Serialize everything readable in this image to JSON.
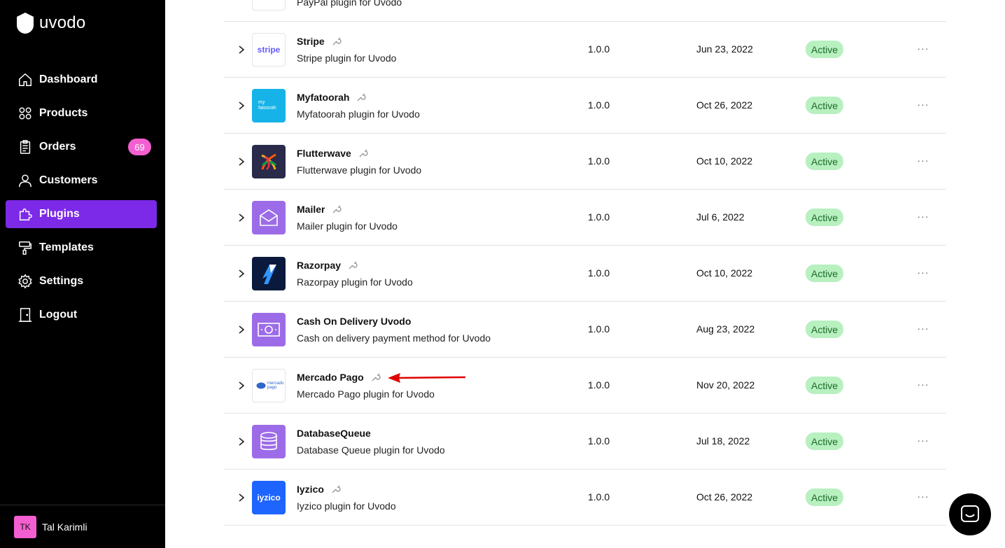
{
  "app": {
    "name": "uvodo"
  },
  "sidebar": {
    "items": [
      {
        "label": "Dashboard",
        "icon": "home-icon",
        "active": false
      },
      {
        "label": "Products",
        "icon": "grid-icon",
        "active": false
      },
      {
        "label": "Orders",
        "icon": "clipboard-icon",
        "active": false,
        "badge": "69"
      },
      {
        "label": "Customers",
        "icon": "user-icon",
        "active": false
      },
      {
        "label": "Plugins",
        "icon": "puzzle-icon",
        "active": true
      },
      {
        "label": "Templates",
        "icon": "paint-roller-icon",
        "active": false
      },
      {
        "label": "Settings",
        "icon": "gear-icon",
        "active": false
      },
      {
        "label": "Logout",
        "icon": "door-icon",
        "active": false
      }
    ],
    "user": {
      "initials": "TK",
      "name": "Tal Karimli"
    }
  },
  "plugins": [
    {
      "name": "",
      "description": "PayPal plugin for Uvodo",
      "version": "",
      "date": "",
      "status": "",
      "logo": "paypal"
    },
    {
      "name": "Stripe",
      "description": "Stripe plugin for Uvodo",
      "version": "1.0.0",
      "date": "Jun 23, 2022",
      "status": "Active",
      "logo": "stripe"
    },
    {
      "name": "Myfatoorah",
      "description": "Myfatoorah plugin for Uvodo",
      "version": "1.0.0",
      "date": "Oct 26, 2022",
      "status": "Active",
      "logo": "myfatoorah"
    },
    {
      "name": "Flutterwave",
      "description": "Flutterwave plugin for Uvodo",
      "version": "1.0.0",
      "date": "Oct 10, 2022",
      "status": "Active",
      "logo": "flutterwave"
    },
    {
      "name": "Mailer",
      "description": "Mailer plugin for Uvodo",
      "version": "1.0.0",
      "date": "Jul 6, 2022",
      "status": "Active",
      "logo": "mailer"
    },
    {
      "name": "Razorpay",
      "description": "Razorpay plugin for Uvodo",
      "version": "1.0.0",
      "date": "Oct 10, 2022",
      "status": "Active",
      "logo": "razorpay"
    },
    {
      "name": "Cash On Delivery Uvodo",
      "description": "Cash on delivery payment method for Uvodo",
      "version": "1.0.0",
      "date": "Aug 23, 2022",
      "status": "Active",
      "logo": "cash"
    },
    {
      "name": "Mercado Pago",
      "description": "Mercado Pago plugin for Uvodo",
      "version": "1.0.0",
      "date": "Nov 20, 2022",
      "status": "Active",
      "logo": "mercadopago"
    },
    {
      "name": "DatabaseQueue",
      "description": "Database Queue plugin for Uvodo",
      "version": "1.0.0",
      "date": "Jul 18, 2022",
      "status": "Active",
      "logo": "database"
    },
    {
      "name": "Iyzico",
      "description": "Iyzico plugin for Uvodo",
      "version": "1.0.0",
      "date": "Oct 26, 2022",
      "status": "Active",
      "logo": "iyzico"
    }
  ],
  "logo_text": {
    "stripe": "stripe",
    "myfatoorah": "my fatoorah",
    "mercadopago": "mercado pago",
    "iyzico": "iyzico"
  },
  "colors": {
    "accent": "#7c2ae8",
    "badge": "#f35fd0",
    "status_bg": "#b8f0c0",
    "annotation_arrow": "#e00000"
  }
}
